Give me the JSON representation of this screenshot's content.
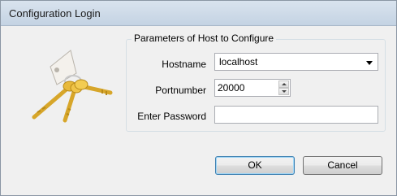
{
  "window": {
    "title": "Configuration Login"
  },
  "icon": {
    "name": "keys-icon"
  },
  "group": {
    "title": "Parameters of Host to Configure"
  },
  "hostname": {
    "label": "Hostname",
    "value": "localhost"
  },
  "portnumber": {
    "label": "Portnumber",
    "value": "20000"
  },
  "password": {
    "label": "Enter Password",
    "value": ""
  },
  "buttons": {
    "ok": "OK",
    "cancel": "Cancel"
  }
}
